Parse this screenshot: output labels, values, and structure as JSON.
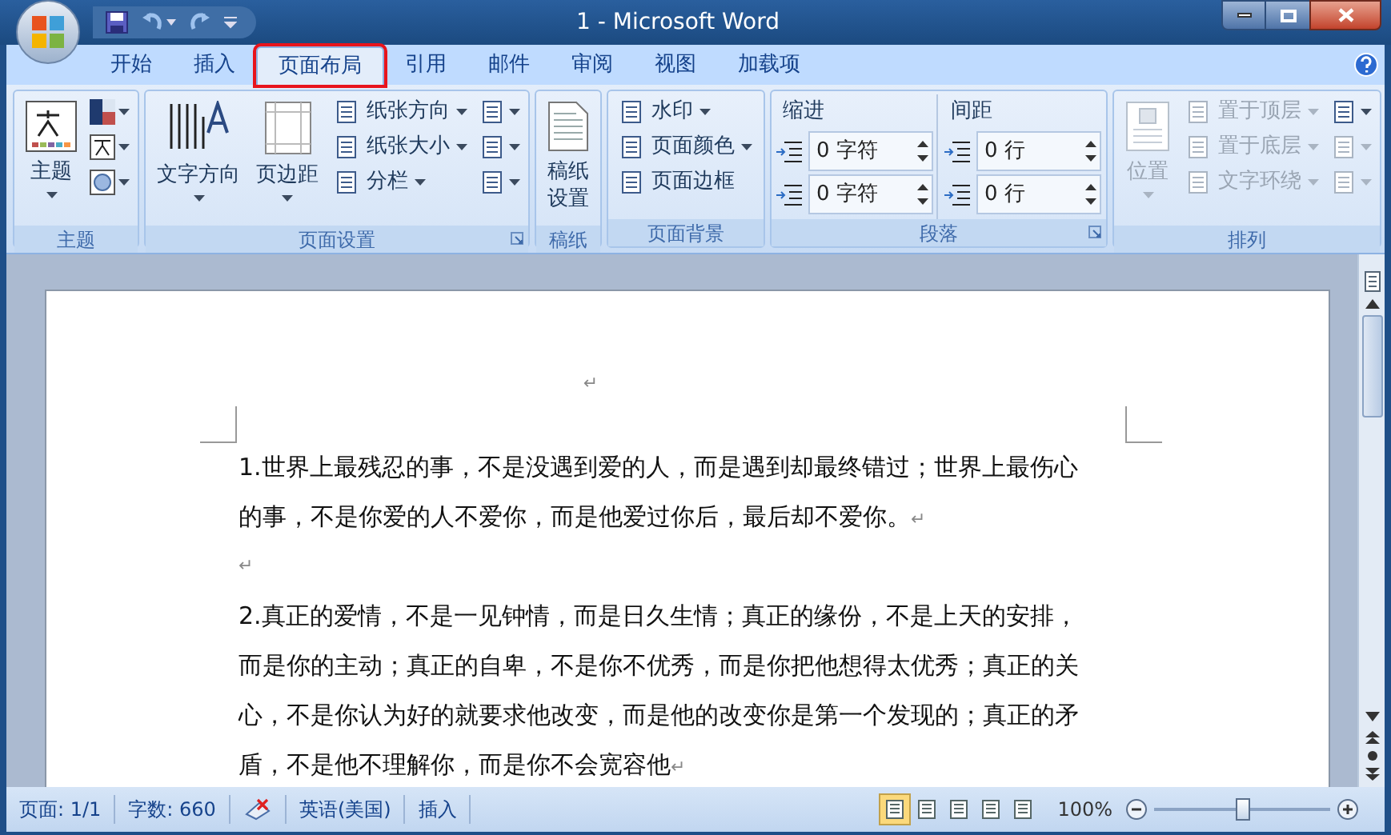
{
  "window": {
    "title": "1 - Microsoft Word"
  },
  "quick_access": [
    {
      "kind": "save"
    },
    {
      "kind": "undo",
      "dropdown": true
    },
    {
      "kind": "redo"
    },
    {
      "kind": "customize"
    }
  ],
  "tabs": [
    {
      "label": "开始",
      "selected": false,
      "highlighted": false
    },
    {
      "label": "插入",
      "selected": false,
      "highlighted": false
    },
    {
      "label": "页面布局",
      "selected": true,
      "highlighted": true
    },
    {
      "label": "引用",
      "selected": false,
      "highlighted": false
    },
    {
      "label": "邮件",
      "selected": false,
      "highlighted": false
    },
    {
      "label": "审阅",
      "selected": false,
      "highlighted": false
    },
    {
      "label": "视图",
      "selected": false,
      "highlighted": false
    },
    {
      "label": "加载项",
      "selected": false,
      "highlighted": false
    }
  ],
  "ribbon": {
    "groups": [
      {
        "label": "主题",
        "launcher": false,
        "columns": [
          [
            {
              "kind": "large",
              "label": "主题",
              "dropdown": true,
              "disabled": false
            }
          ],
          [
            {
              "kind": "icon",
              "dropdown": true,
              "disabled": false
            },
            {
              "kind": "icon",
              "dropdown": true,
              "disabled": false
            },
            {
              "kind": "icon",
              "dropdown": true,
              "disabled": false
            }
          ]
        ]
      },
      {
        "label": "页面设置",
        "launcher": true,
        "columns": [
          [
            {
              "kind": "large",
              "label": "文字方向",
              "dropdown": true,
              "disabled": false
            }
          ],
          [
            {
              "kind": "large",
              "label": "页边距",
              "dropdown": true,
              "disabled": false
            }
          ],
          [
            {
              "kind": "small",
              "label": "纸张方向",
              "dropdown": true,
              "disabled": false
            },
            {
              "kind": "small",
              "label": "纸张大小",
              "dropdown": true,
              "disabled": false
            },
            {
              "kind": "small",
              "label": "分栏",
              "dropdown": true,
              "disabled": false
            }
          ],
          [
            {
              "kind": "icon",
              "dropdown": true,
              "disabled": false
            },
            {
              "kind": "icon",
              "dropdown": true,
              "disabled": false
            },
            {
              "kind": "icon",
              "dropdown": true,
              "disabled": false
            }
          ]
        ]
      },
      {
        "label": "稿纸",
        "launcher": false,
        "columns": [
          [
            {
              "kind": "large",
              "label": "稿纸设置",
              "dropdown": false,
              "disabled": false,
              "wrap": true
            }
          ]
        ]
      },
      {
        "label": "页面背景",
        "launcher": false,
        "columns": [
          [
            {
              "kind": "small",
              "label": "水印",
              "dropdown": true,
              "disabled": false
            },
            {
              "kind": "small",
              "label": "页面颜色",
              "dropdown": true,
              "disabled": false
            },
            {
              "kind": "small",
              "label": "页面边框",
              "dropdown": false,
              "disabled": false
            }
          ]
        ]
      },
      {
        "label": "段落",
        "launcher": true,
        "columns": [
          [
            {
              "kind": "heading",
              "label": "缩进"
            },
            {
              "kind": "spin",
              "value": "0 字符"
            },
            {
              "kind": "spin",
              "value": "0 字符"
            }
          ],
          [
            {
              "kind": "heading",
              "label": "间距"
            },
            {
              "kind": "spin",
              "value": "0 行"
            },
            {
              "kind": "spin",
              "value": "0 行"
            }
          ]
        ]
      },
      {
        "label": "排列",
        "launcher": false,
        "columns": [
          [
            {
              "kind": "large",
              "label": "位置",
              "dropdown": true,
              "disabled": true
            }
          ],
          [
            {
              "kind": "small",
              "label": "置于顶层",
              "dropdown": true,
              "disabled": true
            },
            {
              "kind": "small",
              "label": "置于底层",
              "dropdown": true,
              "disabled": true
            },
            {
              "kind": "small",
              "label": "文字环绕",
              "dropdown": true,
              "disabled": true
            }
          ],
          [
            {
              "kind": "icon",
              "dropdown": true,
              "disabled": false
            },
            {
              "kind": "icon",
              "dropdown": true,
              "disabled": true
            },
            {
              "kind": "icon",
              "dropdown": true,
              "disabled": true
            }
          ]
        ]
      }
    ]
  },
  "document": {
    "paragraphs": [
      {
        "kind": "centered",
        "mark": "↵"
      },
      {
        "kind": "text",
        "text": "1.世界上最残忍的事，不是没遇到爱的人，而是遇到却最终错过；世界上最伤心的事，不是你爱的人不爱你，而是他爱过你后，最后却不爱你。",
        "mark": "↵"
      },
      {
        "kind": "empty",
        "mark": "↵"
      },
      {
        "kind": "text",
        "text": "2.真正的爱情，不是一见钟情，而是日久生情；真正的缘份，不是上天的安排，而是你的主动；真正的自卑，不是你不优秀，而是你把他想得太优秀；真正的关心，不是你认为好的就要求他改变，而是他的改变你是第一个发现的；真正的矛盾，不是他不理解你，而是你不会宽容他",
        "mark": "↵"
      }
    ]
  },
  "status_bar": {
    "page": "页面: 1/1",
    "words": "字数: 660",
    "language": "英语(美国)",
    "mode": "插入",
    "views": [
      {
        "selected": true
      },
      {
        "selected": false
      },
      {
        "selected": false
      },
      {
        "selected": false
      },
      {
        "selected": false
      }
    ],
    "zoom": "100%",
    "zoom_slider": {
      "level": 0.5
    }
  }
}
